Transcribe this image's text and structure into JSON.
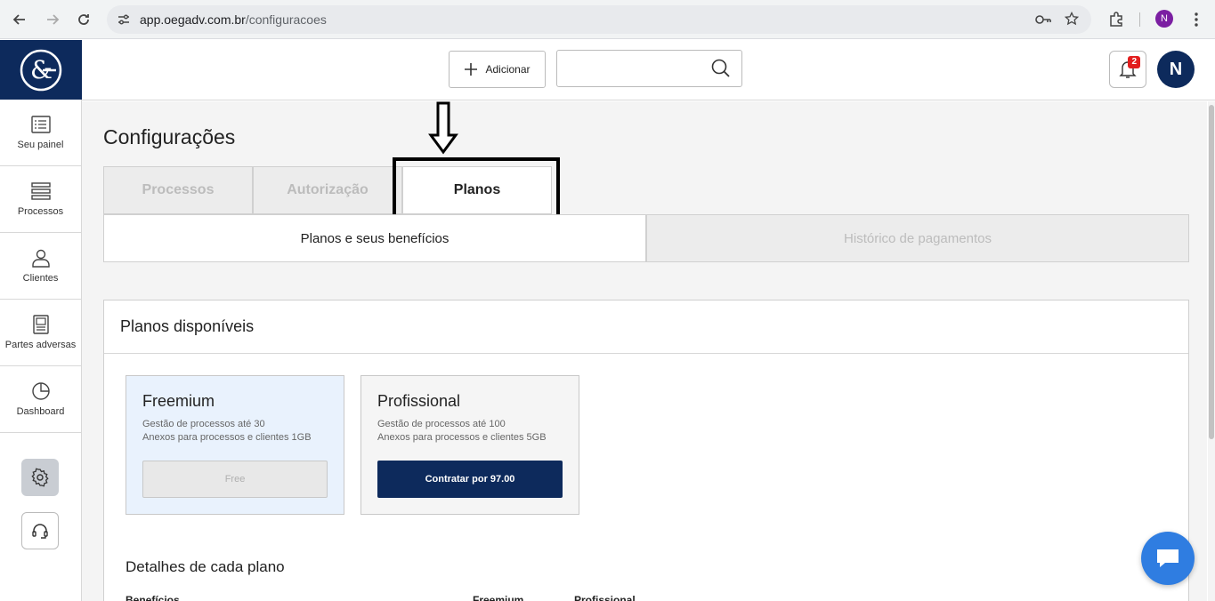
{
  "browser": {
    "url_host": "app.oegadv.com.br",
    "url_path": "/configuracoes",
    "profile_initial": "N"
  },
  "sidebar": {
    "items": [
      {
        "label": "Seu painel",
        "icon": "list-icon"
      },
      {
        "label": "Processos",
        "icon": "stack-icon"
      },
      {
        "label": "Clientes",
        "icon": "user-icon"
      },
      {
        "label": "Partes adversas",
        "icon": "document-icon"
      },
      {
        "label": "Dashboard",
        "icon": "pie-chart-icon"
      }
    ],
    "tools": [
      {
        "icon": "gear-icon",
        "active": true
      },
      {
        "icon": "headset-icon",
        "active": false
      }
    ]
  },
  "header": {
    "add_label": "Adicionar",
    "search_placeholder": "",
    "notification_count": "2",
    "avatar_initial": "N"
  },
  "page": {
    "title": "Configurações",
    "tabs": [
      {
        "label": "Processos",
        "active": false
      },
      {
        "label": "Autorização",
        "active": false
      },
      {
        "label": "Planos",
        "active": true
      }
    ],
    "subtabs": [
      {
        "label": "Planos e seus benefícios",
        "active": true
      },
      {
        "label": "Histórico de pagamentos",
        "active": false
      }
    ]
  },
  "plans": {
    "section_title": "Planos disponíveis",
    "items": [
      {
        "name": "Freemium",
        "features": [
          "Gestão de processos até 30",
          "Anexos para processos e clientes 1GB"
        ],
        "button": "Free"
      },
      {
        "name": "Profissional",
        "features": [
          "Gestão de processos até 100",
          "Anexos para processos e clientes 5GB"
        ],
        "button": "Contratar por 97.00"
      }
    ],
    "details_title": "Detalhes de cada plano",
    "details_columns": [
      "Benefícios",
      "Freemium",
      "Profissional"
    ]
  },
  "colors": {
    "brand_navy": "#0d2a5c",
    "accent_blue": "#2f7de1",
    "badge_red": "#e21d1d",
    "free_bg": "#e9f2fd"
  }
}
